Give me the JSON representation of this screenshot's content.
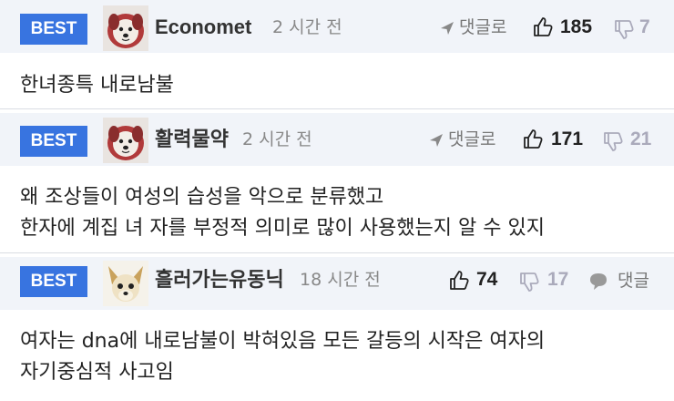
{
  "comments": [
    {
      "badge": "BEST",
      "username": "Economet",
      "time": "2 시간 전",
      "reply_label": "댓글로",
      "likes": "185",
      "dislikes": "7",
      "lines": [
        "한녀종특 내로남불"
      ]
    },
    {
      "badge": "BEST",
      "username": "활력물약",
      "time": "2 시간 전",
      "reply_label": "댓글로",
      "likes": "171",
      "dislikes": "21",
      "lines": [
        "왜 조상들이 여성의 습성을 악으로 분류했고",
        "한자에 계집 녀 자를 부정적 의미로 많이 사용했는지 알 수 있지"
      ]
    },
    {
      "badge": "BEST",
      "username": "흘러가는유동닉",
      "time": "18 시간 전",
      "likes": "74",
      "dislikes": "17",
      "comment_label": "댓글",
      "lines": [
        "여자는 dna에 내로남불이 박혀있음 모든 갈등의 시작은 여자의",
        "자기중심적 사고임"
      ]
    }
  ],
  "icons": {
    "avatar1": "dog-avatar-icon",
    "avatar2": "dog-avatar-icon",
    "avatar3": "chihuahua-avatar-icon",
    "reply": "send-arrow-icon",
    "like": "thumbs-up-icon",
    "dislike": "thumbs-down-icon",
    "comment": "speech-bubble-icon"
  },
  "colors": {
    "badge": "#3874e0",
    "header_bg": "#f1f4f9"
  }
}
